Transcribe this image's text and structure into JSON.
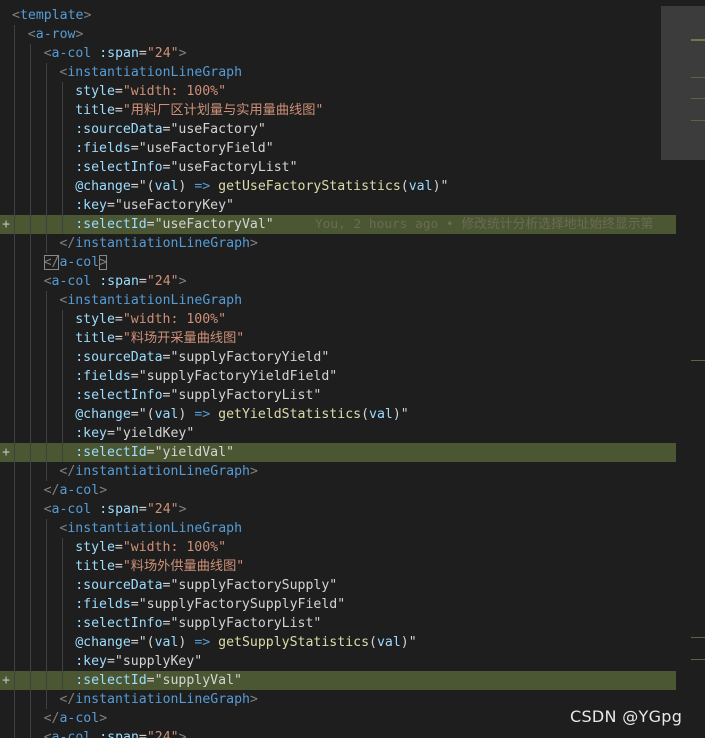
{
  "editor": {
    "blame": "You, 2 hours ago • 修改统计分析选择地址始终显示第",
    "lines": [
      {
        "indent": 0,
        "tokens": [
          [
            "p",
            "<"
          ],
          [
            "t",
            "template"
          ],
          [
            "p",
            ">"
          ]
        ]
      },
      {
        "indent": 1,
        "tokens": [
          [
            "p",
            "<"
          ],
          [
            "t",
            "a-row"
          ],
          [
            "p",
            ">"
          ]
        ]
      },
      {
        "indent": 2,
        "tokens": [
          [
            "p",
            "<"
          ],
          [
            "t",
            "a-col"
          ],
          [
            "d",
            " "
          ],
          [
            "a",
            ":span"
          ],
          [
            "d",
            "="
          ],
          [
            "s",
            "\"24\""
          ],
          [
            "p",
            ">"
          ]
        ]
      },
      {
        "indent": 3,
        "tokens": [
          [
            "p",
            "<"
          ],
          [
            "t",
            "instantiationLineGraph"
          ]
        ]
      },
      {
        "indent": 4,
        "tokens": [
          [
            "a",
            "style"
          ],
          [
            "d",
            "="
          ],
          [
            "s",
            "\"width: 100%\""
          ]
        ]
      },
      {
        "indent": 4,
        "tokens": [
          [
            "a",
            "title"
          ],
          [
            "d",
            "="
          ],
          [
            "s",
            "\"用料厂区计划量与实用量曲线图\""
          ]
        ]
      },
      {
        "indent": 4,
        "tokens": [
          [
            "a",
            ":sourceData"
          ],
          [
            "d",
            "="
          ],
          [
            "d",
            "\"useFactory\""
          ]
        ]
      },
      {
        "indent": 4,
        "tokens": [
          [
            "a",
            ":fields"
          ],
          [
            "d",
            "="
          ],
          [
            "d",
            "\"useFactoryField\""
          ]
        ]
      },
      {
        "indent": 4,
        "tokens": [
          [
            "a",
            ":selectInfo"
          ],
          [
            "d",
            "="
          ],
          [
            "d",
            "\"useFactoryList\""
          ]
        ]
      },
      {
        "indent": 4,
        "tokens": [
          [
            "a",
            "@change"
          ],
          [
            "d",
            "=\"("
          ],
          [
            "a",
            "val"
          ],
          [
            "d",
            ") "
          ],
          [
            "k",
            "=>"
          ],
          [
            "d",
            " "
          ],
          [
            "f",
            "getUseFactoryStatistics"
          ],
          [
            "d",
            "("
          ],
          [
            "a",
            "val"
          ],
          [
            "d",
            ")\""
          ]
        ]
      },
      {
        "indent": 4,
        "tokens": [
          [
            "a",
            ":key"
          ],
          [
            "d",
            "="
          ],
          [
            "d",
            "\"useFactoryKey\""
          ]
        ]
      },
      {
        "indent": 4,
        "hl": true,
        "plus": true,
        "tokens": [
          [
            "a",
            ":selectId"
          ],
          [
            "d",
            "="
          ],
          [
            "d",
            "\"useFactoryVal\""
          ]
        ]
      },
      {
        "indent": 3,
        "tokens": [
          [
            "p",
            "</"
          ],
          [
            "t",
            "instantiationLineGraph"
          ],
          [
            "p",
            ">"
          ]
        ]
      },
      {
        "indent": 2,
        "tokens": [
          [
            "p",
            "</"
          ],
          [
            "t",
            "a-col"
          ],
          [
            "p",
            ">"
          ]
        ],
        "bracket": true
      },
      {
        "indent": 2,
        "tokens": [
          [
            "p",
            "<"
          ],
          [
            "t",
            "a-col"
          ],
          [
            "d",
            " "
          ],
          [
            "a",
            ":span"
          ],
          [
            "d",
            "="
          ],
          [
            "s",
            "\"24\""
          ],
          [
            "p",
            ">"
          ]
        ]
      },
      {
        "indent": 3,
        "tokens": [
          [
            "p",
            "<"
          ],
          [
            "t",
            "instantiationLineGraph"
          ]
        ]
      },
      {
        "indent": 4,
        "tokens": [
          [
            "a",
            "style"
          ],
          [
            "d",
            "="
          ],
          [
            "s",
            "\"width: 100%\""
          ]
        ]
      },
      {
        "indent": 4,
        "tokens": [
          [
            "a",
            "title"
          ],
          [
            "d",
            "="
          ],
          [
            "s",
            "\"料场开采量曲线图\""
          ]
        ]
      },
      {
        "indent": 4,
        "tokens": [
          [
            "a",
            ":sourceData"
          ],
          [
            "d",
            "="
          ],
          [
            "d",
            "\"supplyFactoryYield\""
          ]
        ]
      },
      {
        "indent": 4,
        "tokens": [
          [
            "a",
            ":fields"
          ],
          [
            "d",
            "="
          ],
          [
            "d",
            "\"supplyFactoryYieldField\""
          ]
        ]
      },
      {
        "indent": 4,
        "tokens": [
          [
            "a",
            ":selectInfo"
          ],
          [
            "d",
            "="
          ],
          [
            "d",
            "\"supplyFactoryList\""
          ]
        ]
      },
      {
        "indent": 4,
        "tokens": [
          [
            "a",
            "@change"
          ],
          [
            "d",
            "=\"("
          ],
          [
            "a",
            "val"
          ],
          [
            "d",
            ") "
          ],
          [
            "k",
            "=>"
          ],
          [
            "d",
            " "
          ],
          [
            "f",
            "getYieldStatistics"
          ],
          [
            "d",
            "("
          ],
          [
            "a",
            "val"
          ],
          [
            "d",
            ")\""
          ]
        ]
      },
      {
        "indent": 4,
        "tokens": [
          [
            "a",
            ":key"
          ],
          [
            "d",
            "="
          ],
          [
            "d",
            "\"yieldKey\""
          ]
        ]
      },
      {
        "indent": 4,
        "hl": true,
        "plus": true,
        "tokens": [
          [
            "a",
            ":selectId"
          ],
          [
            "d",
            "="
          ],
          [
            "d",
            "\"yieldVal\""
          ]
        ]
      },
      {
        "indent": 3,
        "tokens": [
          [
            "p",
            "</"
          ],
          [
            "t",
            "instantiationLineGraph"
          ],
          [
            "p",
            ">"
          ]
        ]
      },
      {
        "indent": 2,
        "tokens": [
          [
            "p",
            "</"
          ],
          [
            "t",
            "a-col"
          ],
          [
            "p",
            ">"
          ]
        ]
      },
      {
        "indent": 2,
        "tokens": [
          [
            "p",
            "<"
          ],
          [
            "t",
            "a-col"
          ],
          [
            "d",
            " "
          ],
          [
            "a",
            ":span"
          ],
          [
            "d",
            "="
          ],
          [
            "s",
            "\"24\""
          ],
          [
            "p",
            ">"
          ]
        ]
      },
      {
        "indent": 3,
        "tokens": [
          [
            "p",
            "<"
          ],
          [
            "t",
            "instantiationLineGraph"
          ]
        ]
      },
      {
        "indent": 4,
        "tokens": [
          [
            "a",
            "style"
          ],
          [
            "d",
            "="
          ],
          [
            "s",
            "\"width: 100%\""
          ]
        ]
      },
      {
        "indent": 4,
        "tokens": [
          [
            "a",
            "title"
          ],
          [
            "d",
            "="
          ],
          [
            "s",
            "\"料场外供量曲线图\""
          ]
        ]
      },
      {
        "indent": 4,
        "tokens": [
          [
            "a",
            ":sourceData"
          ],
          [
            "d",
            "="
          ],
          [
            "d",
            "\"supplyFactorySupply\""
          ]
        ]
      },
      {
        "indent": 4,
        "tokens": [
          [
            "a",
            ":fields"
          ],
          [
            "d",
            "="
          ],
          [
            "d",
            "\"supplyFactorySupplyField\""
          ]
        ]
      },
      {
        "indent": 4,
        "tokens": [
          [
            "a",
            ":selectInfo"
          ],
          [
            "d",
            "="
          ],
          [
            "d",
            "\"supplyFactoryList\""
          ]
        ]
      },
      {
        "indent": 4,
        "tokens": [
          [
            "a",
            "@change"
          ],
          [
            "d",
            "=\"("
          ],
          [
            "a",
            "val"
          ],
          [
            "d",
            ") "
          ],
          [
            "k",
            "=>"
          ],
          [
            "d",
            " "
          ],
          [
            "f",
            "getSupplyStatistics"
          ],
          [
            "d",
            "("
          ],
          [
            "a",
            "val"
          ],
          [
            "d",
            ")\""
          ]
        ]
      },
      {
        "indent": 4,
        "tokens": [
          [
            "a",
            ":key"
          ],
          [
            "d",
            "="
          ],
          [
            "d",
            "\"supplyKey\""
          ]
        ]
      },
      {
        "indent": 4,
        "hl": true,
        "plus": true,
        "tokens": [
          [
            "a",
            ":selectId"
          ],
          [
            "d",
            "="
          ],
          [
            "d",
            "\"supplyVal\""
          ]
        ]
      },
      {
        "indent": 3,
        "tokens": [
          [
            "p",
            "</"
          ],
          [
            "t",
            "instantiationLineGraph"
          ],
          [
            "p",
            ">"
          ]
        ]
      },
      {
        "indent": 2,
        "tokens": [
          [
            "p",
            "</"
          ],
          [
            "t",
            "a-col"
          ],
          [
            "p",
            ">"
          ]
        ]
      },
      {
        "indent": 2,
        "tokens": [
          [
            "p",
            "<"
          ],
          [
            "t",
            "a-col"
          ],
          [
            "d",
            " "
          ],
          [
            "a",
            ":span"
          ],
          [
            "d",
            "="
          ],
          [
            "s",
            "\"24\""
          ],
          [
            "p",
            ">"
          ]
        ]
      }
    ]
  },
  "watermark": "CSDN @YGpg",
  "gutter_marker": "+",
  "colors": {
    "background": "#1e1e1e",
    "highlight": "#4b5632",
    "tag": "#569cd6",
    "attribute": "#9cdcfe",
    "string": "#ce9178",
    "function": "#dcdcaa",
    "punctuation": "#808080"
  }
}
